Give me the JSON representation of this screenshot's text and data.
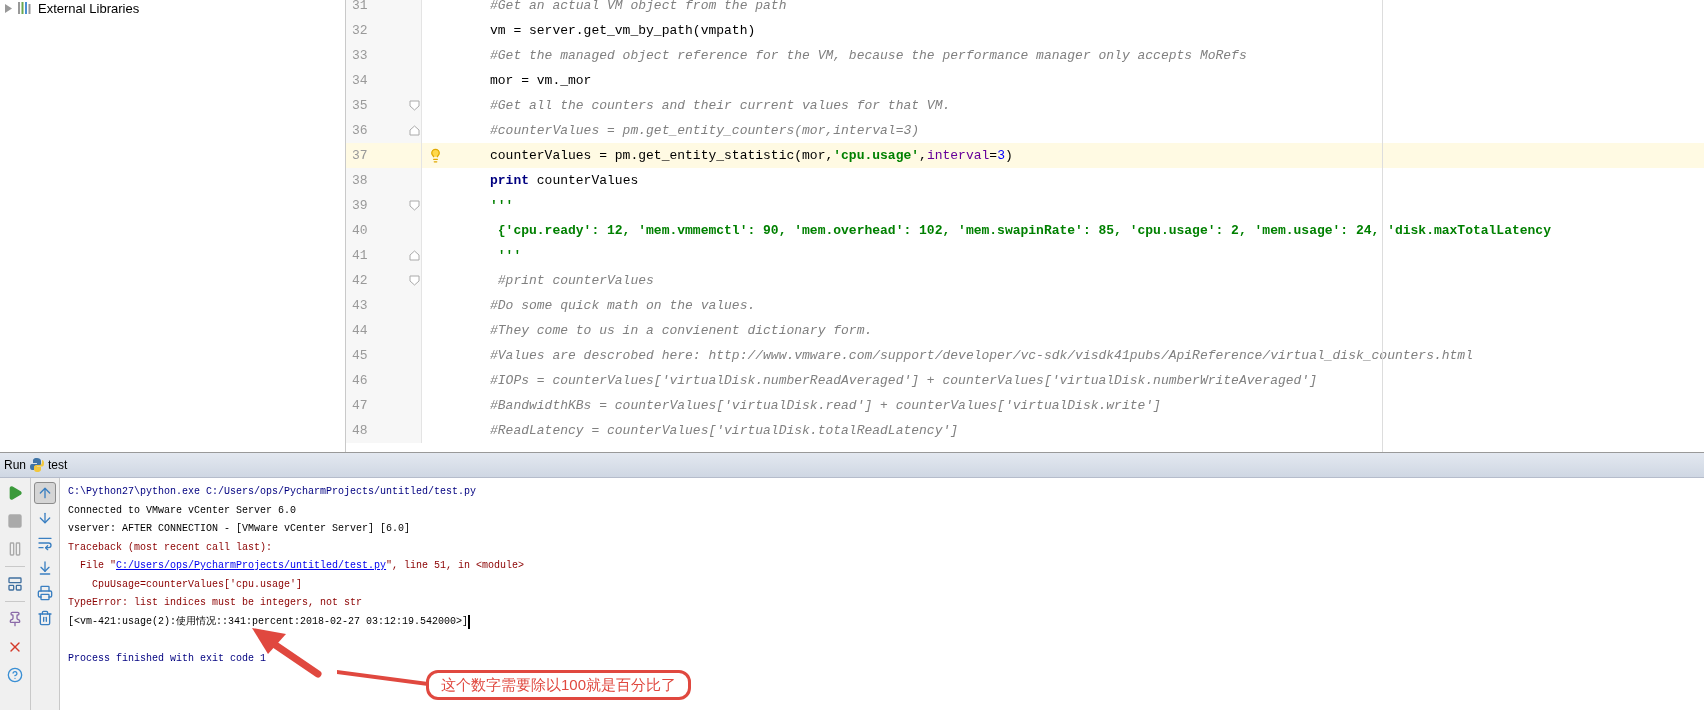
{
  "project_tree": {
    "items": [
      {
        "label": "External Libraries",
        "expanded": false
      }
    ]
  },
  "editor": {
    "lines": [
      {
        "number": "31",
        "current": false,
        "bulb": false,
        "tokens": [
          {
            "kind": "comment",
            "text": "#Get an actual VM object from the path"
          }
        ]
      },
      {
        "number": "32",
        "current": false,
        "bulb": false,
        "tokens": [
          {
            "kind": "plain",
            "text": "vm = server.get_vm_by_path(vmpath)"
          }
        ]
      },
      {
        "number": "33",
        "current": false,
        "bulb": false,
        "tokens": [
          {
            "kind": "comment",
            "text": "#Get the managed object reference for the VM, because the performance manager only accepts MoRefs"
          }
        ]
      },
      {
        "number": "34",
        "current": false,
        "bulb": false,
        "tokens": [
          {
            "kind": "plain",
            "text": "mor = vm._mor"
          }
        ]
      },
      {
        "number": "35",
        "current": false,
        "bulb": false,
        "fold": {
          "kind": "start"
        },
        "tokens": [
          {
            "kind": "comment",
            "text": "#Get all the counters and their current values for that VM."
          }
        ]
      },
      {
        "number": "36",
        "current": false,
        "bulb": false,
        "fold": {
          "kind": "end"
        },
        "tokens": [
          {
            "kind": "comment",
            "text": "#counterValues = pm.get_entity_counters(mor,interval=3)"
          }
        ]
      },
      {
        "number": "37",
        "current": true,
        "bulb": true,
        "tokens": [
          {
            "kind": "plain",
            "text": "counterValues = pm.get_entity_statistic(mor,"
          },
          {
            "kind": "string",
            "text": "'cpu.usage'"
          },
          {
            "kind": "plain",
            "text": ","
          },
          {
            "kind": "param",
            "text": "interval"
          },
          {
            "kind": "plain",
            "text": "="
          },
          {
            "kind": "number",
            "text": "3"
          },
          {
            "kind": "plain",
            "text": ")"
          }
        ]
      },
      {
        "number": "38",
        "current": false,
        "bulb": false,
        "tokens": [
          {
            "kind": "keyword",
            "text": "print"
          },
          {
            "kind": "plain",
            "text": " counterValues"
          }
        ]
      },
      {
        "number": "39",
        "current": false,
        "bulb": false,
        "fold": {
          "kind": "start"
        },
        "tokens": [
          {
            "kind": "string",
            "text": "'''"
          }
        ]
      },
      {
        "number": "40",
        "current": false,
        "bulb": false,
        "tokens": [
          {
            "kind": "string",
            "text": " {'cpu.ready': 12, 'mem.vmmemctl': 90, 'mem.overhead': 102, 'mem.swapinRate': 85, 'cpu.usage': 2, 'mem.usage': 24, 'disk.maxTotalLatency"
          }
        ]
      },
      {
        "number": "41",
        "current": false,
        "bulb": false,
        "fold": {
          "kind": "end"
        },
        "tokens": [
          {
            "kind": "string",
            "text": " '''"
          }
        ]
      },
      {
        "number": "42",
        "current": false,
        "bulb": false,
        "fold": {
          "kind": "start"
        },
        "tokens": [
          {
            "kind": "comment",
            "text": " #print counterValues"
          }
        ]
      },
      {
        "number": "43",
        "current": false,
        "bulb": false,
        "tokens": [
          {
            "kind": "comment",
            "text": "#Do some quick math on the values."
          }
        ]
      },
      {
        "number": "44",
        "current": false,
        "bulb": false,
        "tokens": [
          {
            "kind": "comment",
            "text": "#They come to us in a convienent dictionary form."
          }
        ]
      },
      {
        "number": "45",
        "current": false,
        "bulb": false,
        "tokens": [
          {
            "kind": "comment",
            "text": "#Values are descrobed here: http://www.vmware.com/support/developer/vc-sdk/visdk41pubs/ApiReference/virtual_disk_counters.html"
          }
        ]
      },
      {
        "number": "46",
        "current": false,
        "bulb": false,
        "tokens": [
          {
            "kind": "comment",
            "text": "#IOPs = counterValues['virtualDisk.numberReadAveraged'] + counterValues['virtualDisk.numberWriteAveraged']"
          }
        ]
      },
      {
        "number": "47",
        "current": false,
        "bulb": false,
        "tokens": [
          {
            "kind": "comment",
            "text": "#BandwidthKBs = counterValues['virtualDisk.read'] + counterValues['virtualDisk.write']"
          }
        ]
      },
      {
        "number": "48",
        "current": false,
        "bulb": false,
        "tokens": [
          {
            "kind": "comment",
            "text": "#ReadLatency = counterValues['virtualDisk.totalReadLatency']"
          }
        ]
      }
    ]
  },
  "run_panel": {
    "title": "Run",
    "config": "test",
    "side_tools": [
      {
        "kind": "run"
      },
      {
        "kind": "stop"
      },
      {
        "kind": "pause"
      },
      {
        "kind": "layout"
      },
      {
        "kind": "pin"
      },
      {
        "kind": "close"
      },
      {
        "kind": "help"
      }
    ],
    "console_tools": [
      {
        "kind": "up",
        "selected": true
      },
      {
        "kind": "down",
        "selected": false
      },
      {
        "kind": "wrap",
        "selected": false
      },
      {
        "kind": "scroll-end",
        "selected": false
      },
      {
        "kind": "print",
        "selected": false
      },
      {
        "kind": "trash",
        "selected": false
      }
    ],
    "console": [
      {
        "segments": [
          {
            "kind": "command",
            "text": "C:\\Python27\\python.exe C:/Users/ops/PycharmProjects/untitled/test.py"
          }
        ]
      },
      {
        "segments": [
          {
            "kind": "output",
            "text": "Connected to VMware vCenter Server 6.0"
          }
        ]
      },
      {
        "segments": [
          {
            "kind": "output",
            "text": "vserver: AFTER CONNECTION - [VMware vCenter Server] [6.0]"
          }
        ]
      },
      {
        "segments": [
          {
            "kind": "error",
            "text": "Traceback (most recent call last):"
          }
        ]
      },
      {
        "segments": [
          {
            "kind": "error",
            "text": "  File \""
          },
          {
            "kind": "link",
            "text": "C:/Users/ops/PycharmProjects/untitled/test.py"
          },
          {
            "kind": "error",
            "text": "\", line 51, in <module>"
          }
        ]
      },
      {
        "segments": [
          {
            "kind": "error",
            "text": "    CpuUsage=counterValues['cpu.usage']"
          }
        ]
      },
      {
        "segments": [
          {
            "kind": "error",
            "text": "TypeError: list indices must be integers, not str"
          }
        ]
      },
      {
        "cursor": true,
        "segments": [
          {
            "kind": "output",
            "text": "[<vm-421:usage(2):使用情况::341:percent:2018-02-27 03:12:19.542000>]"
          }
        ]
      },
      {
        "gap_before": true,
        "segments": [
          {
            "kind": "command",
            "text": "Process finished with exit code 1"
          }
        ]
      }
    ]
  },
  "annotation": {
    "text": "这个数字需要除以100就是百分比了"
  }
}
